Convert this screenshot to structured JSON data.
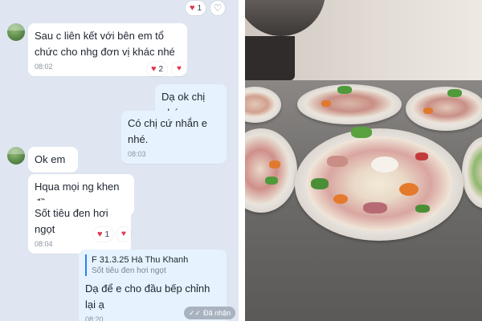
{
  "chat": {
    "top_reactions": {
      "count": "1"
    },
    "messages": [
      {
        "id": "m1",
        "direction": "incoming",
        "text": "Sau c liên kết với bên em tổ chức cho nhg đơn vị khác nhé",
        "time": "08:02",
        "reaction_count": "2"
      },
      {
        "id": "m2",
        "direction": "outgoing",
        "text": "Dạ ok chị nhé"
      },
      {
        "id": "m3",
        "direction": "outgoing",
        "text": "Có chị cứ nhắn e nhé.",
        "time": "08:03"
      },
      {
        "id": "m4",
        "direction": "incoming",
        "text": "Ok em"
      },
      {
        "id": "m5",
        "direction": "incoming",
        "text": "Hqua mọi ng khen đồ"
      },
      {
        "id": "m6",
        "direction": "incoming",
        "text": "Sốt tiêu đen hơi ngọt",
        "time": "08:04",
        "reaction_count": "1"
      },
      {
        "id": "m7",
        "direction": "outgoing",
        "quote": {
          "author": "F 31.3.25 Hà Thu Khanh",
          "text": "Sốt tiêu đen hơi ngọt"
        },
        "text": "Dạ để e cho đầu bếp chỉnh lại ạ",
        "time": "08:20"
      }
    ],
    "status": "Đã nhận",
    "colors": {
      "background": "#dfe6f1",
      "incoming": "#ffffff",
      "outgoing": "#e6f2fd",
      "heart": "#e0364a",
      "quote_bar": "#2a82f0"
    },
    "icons": {
      "reaction": "heart-icon",
      "add_reaction": "heart-outline-icon",
      "status": "double-check-icon"
    }
  }
}
